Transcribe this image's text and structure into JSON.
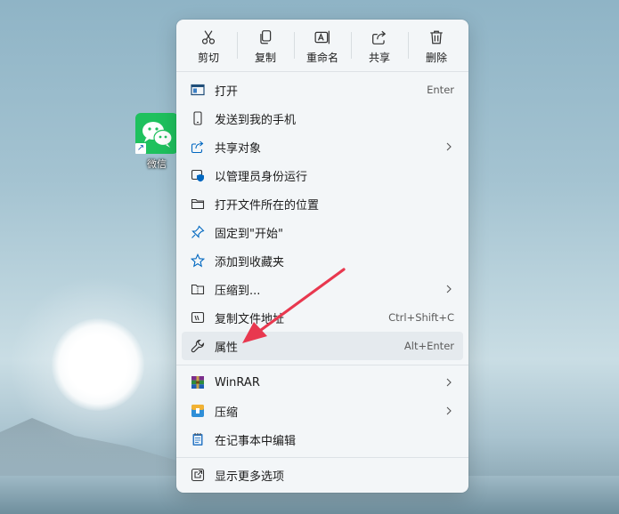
{
  "desktop": {
    "icon_label": "微信",
    "shortcut_glyph": "↗"
  },
  "toolbar": [
    {
      "label": "剪切",
      "icon": "scissors-icon"
    },
    {
      "label": "复制",
      "icon": "copy-icon"
    },
    {
      "label": "重命名",
      "icon": "rename-icon"
    },
    {
      "label": "共享",
      "icon": "share-icon"
    },
    {
      "label": "删除",
      "icon": "trash-icon"
    }
  ],
  "menu": {
    "group1": [
      {
        "label": "打开",
        "shortcut": "Enter",
        "icon": "open-window-icon"
      },
      {
        "label": "发送到我的手机",
        "icon": "phone-icon"
      },
      {
        "label": "共享对象",
        "icon": "share-icon",
        "submenu": true
      },
      {
        "label": "以管理员身份运行",
        "icon": "shield-icon"
      },
      {
        "label": "打开文件所在的位置",
        "icon": "folder-icon"
      },
      {
        "label": "固定到\"开始\"",
        "icon": "pin-icon"
      },
      {
        "label": "添加到收藏夹",
        "icon": "star-icon"
      },
      {
        "label": "压缩到...",
        "icon": "zip-folder-icon",
        "submenu": true
      },
      {
        "label": "复制文件地址",
        "shortcut": "Ctrl+Shift+C",
        "icon": "copy-path-icon"
      },
      {
        "label": "属性",
        "shortcut": "Alt+Enter",
        "icon": "wrench-icon",
        "highlighted": true
      }
    ],
    "group2": [
      {
        "label": "WinRAR",
        "icon": "winrar-icon",
        "submenu": true
      },
      {
        "label": "压缩",
        "icon": "compress-icon",
        "submenu": true
      },
      {
        "label": "在记事本中编辑",
        "icon": "notepad-icon"
      }
    ],
    "group3": [
      {
        "label": "显示更多选项",
        "icon": "more-options-icon"
      }
    ]
  },
  "colors": {
    "accent": "#0067c0",
    "annotation_arrow": "#e8384f",
    "wechat_green": "#1fc15e"
  }
}
